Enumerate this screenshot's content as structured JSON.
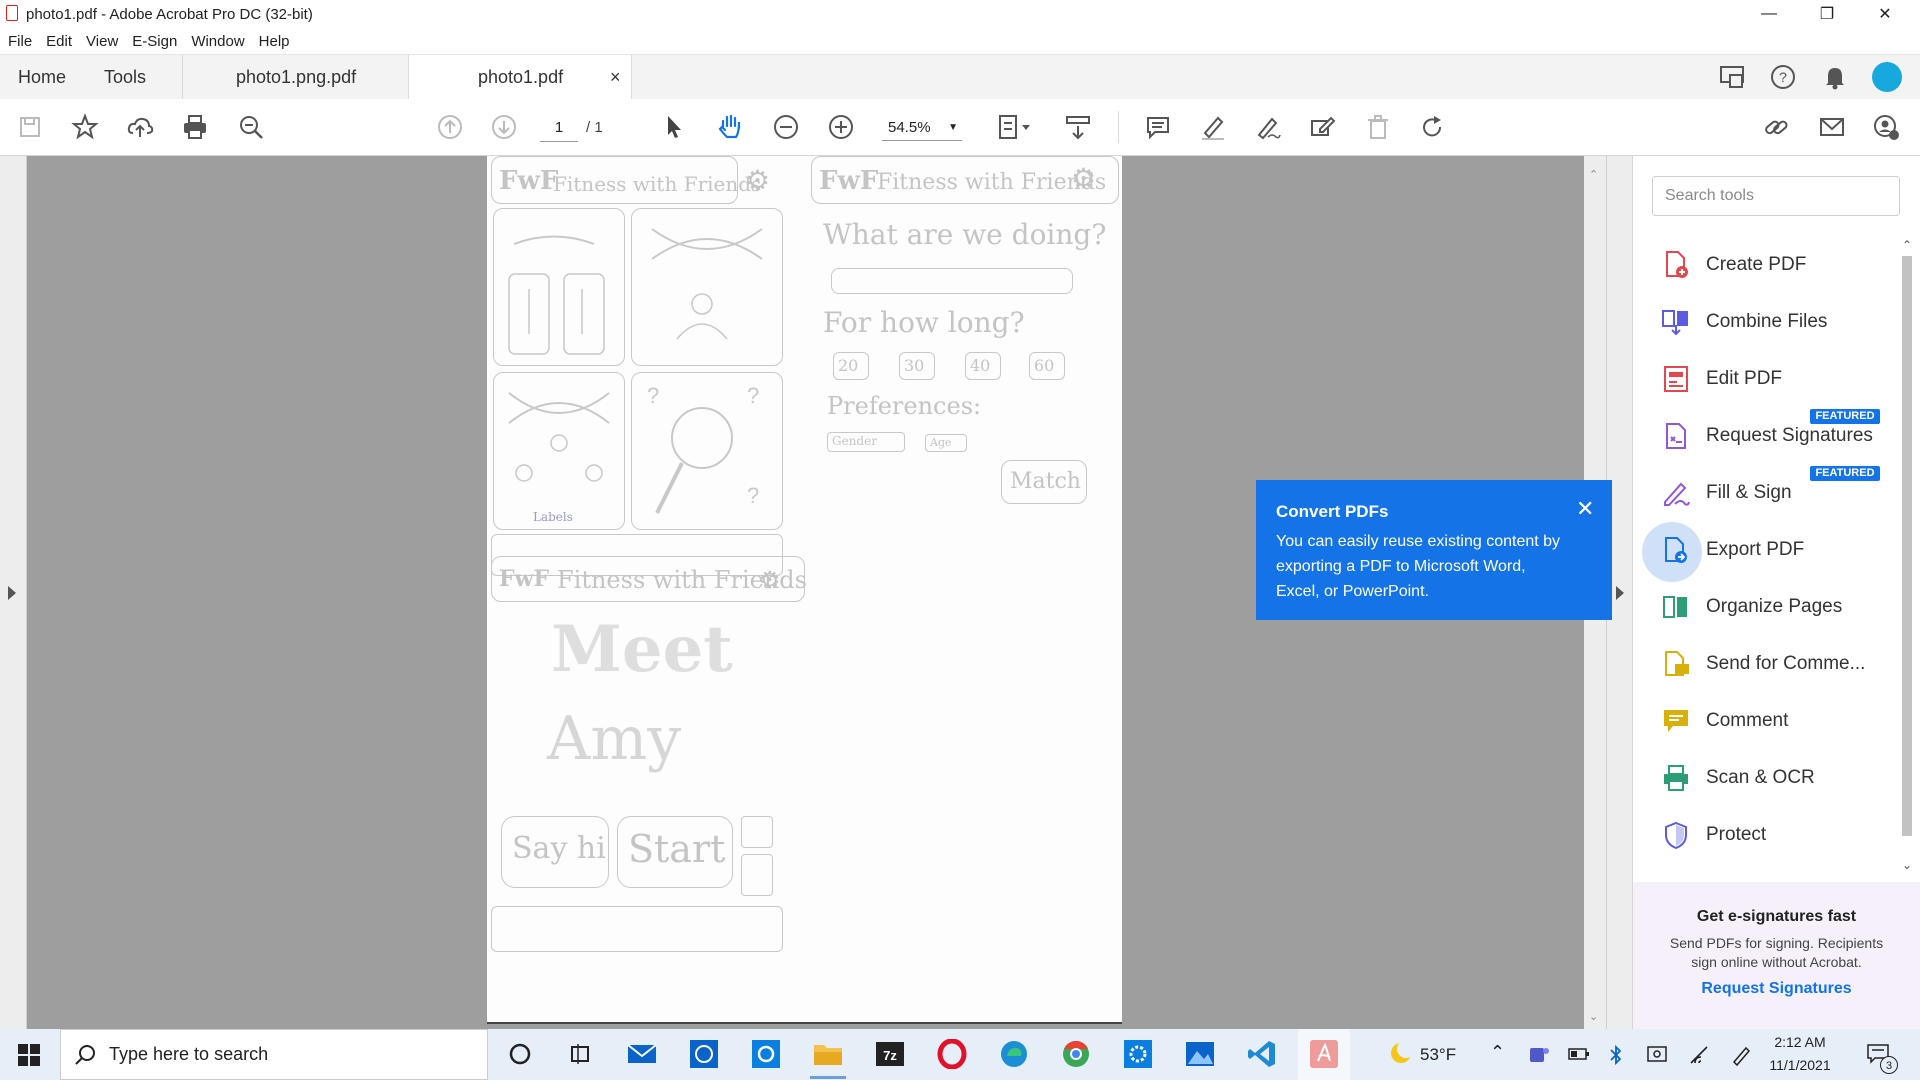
{
  "window": {
    "title": "photo1.pdf - Adobe Acrobat Pro DC (32-bit)"
  },
  "menu": {
    "items": [
      "File",
      "Edit",
      "View",
      "E-Sign",
      "Window",
      "Help"
    ]
  },
  "tabs": {
    "home": "Home",
    "tools": "Tools",
    "doc1": "photo1.png.pdf",
    "doc2": "photo1.pdf",
    "close": "×"
  },
  "toolbar": {
    "page_current": "1",
    "page_total": "/ 1",
    "zoom": "54.5%"
  },
  "sketch": {
    "brand": "FwF",
    "app_name": "Fitness with Friends",
    "question": "What are we doing?",
    "duration_q": "For how long?",
    "durations": [
      "20",
      "30",
      "40",
      "60"
    ],
    "preferences": "Preferences:",
    "gender": "Gender",
    "age": "Age",
    "match": "Match",
    "labels": "Labels",
    "meet": "Meet",
    "name": "Amy",
    "say_hi": "Say hi",
    "start": "Start"
  },
  "right_panel": {
    "search_placeholder": "Search tools",
    "tools": [
      {
        "label": "Create PDF",
        "icon": "create-pdf-icon",
        "color": "#e34850"
      },
      {
        "label": "Combine Files",
        "icon": "combine-files-icon",
        "color": "#5c5ce0"
      },
      {
        "label": "Edit PDF",
        "icon": "edit-pdf-icon",
        "color": "#e34850"
      },
      {
        "label": "Request Signatures",
        "icon": "request-signatures-icon",
        "color": "#9256d9",
        "badge": "FEATURED"
      },
      {
        "label": "Fill & Sign",
        "icon": "fill-sign-icon",
        "color": "#9256d9",
        "badge": "FEATURED"
      },
      {
        "label": "Export PDF",
        "icon": "export-pdf-icon",
        "color": "#1473e6"
      },
      {
        "label": "Organize Pages",
        "icon": "organize-pages-icon",
        "color": "#2d9d78"
      },
      {
        "label": "Send for Comme...",
        "icon": "send-for-comment-icon",
        "color": "#d7b00b"
      },
      {
        "label": "Comment",
        "icon": "comment-icon",
        "color": "#d7b00b"
      },
      {
        "label": "Scan & OCR",
        "icon": "scan-ocr-icon",
        "color": "#2d9d78"
      },
      {
        "label": "Protect",
        "icon": "protect-icon",
        "color": "#5c5ce0"
      }
    ],
    "promo": {
      "title": "Get e-signatures fast",
      "body_line1": "Send PDFs for signing. Recipients",
      "body_line2": "sign online without Acrobat.",
      "link": "Request Signatures"
    }
  },
  "callout": {
    "title": "Convert PDFs",
    "body_line1": "You can easily reuse existing content by",
    "body_line2": "exporting a PDF to Microsoft Word,",
    "body_line3": "Excel, or PowerPoint."
  },
  "taskbar": {
    "search_placeholder": "Type here to search",
    "weather": "53°F",
    "time": "2:12 AM",
    "date": "11/1/2021",
    "notifications": "3"
  },
  "colors": {
    "accent": "#1473e6",
    "doc_bg": "#9e9e9e",
    "acrobat_red": "#d9231e"
  }
}
